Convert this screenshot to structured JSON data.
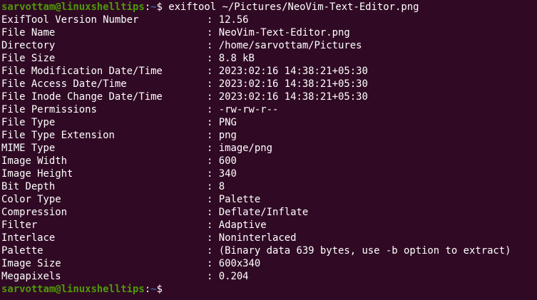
{
  "colors": {
    "background": "#300a24",
    "text": "#ffffff",
    "prompt_user": "#4e9a06",
    "prompt_path": "#3465a4"
  },
  "prompt": {
    "user_host": "sarvottam@linuxshelltips",
    "path": "~",
    "symbol": "$ "
  },
  "command": "exiftool ~/Pictures/NeoVim-Text-Editor.png",
  "rows": [
    {
      "key": "ExifTool Version Number",
      "sep": ": ",
      "value": "12.56"
    },
    {
      "key": "File Name",
      "sep": ": ",
      "value": "NeoVim-Text-Editor.png"
    },
    {
      "key": "Directory",
      "sep": ": ",
      "value": "/home/sarvottam/Pictures"
    },
    {
      "key": "File Size",
      "sep": ": ",
      "value": "8.8 kB"
    },
    {
      "key": "File Modification Date/Time",
      "sep": ": ",
      "value": "2023:02:16 14:38:21+05:30"
    },
    {
      "key": "File Access Date/Time",
      "sep": ": ",
      "value": "2023:02:16 14:38:21+05:30"
    },
    {
      "key": "File Inode Change Date/Time",
      "sep": ": ",
      "value": "2023:02:16 14:38:21+05:30"
    },
    {
      "key": "File Permissions",
      "sep": ": ",
      "value": "-rw-rw-r--"
    },
    {
      "key": "File Type",
      "sep": ": ",
      "value": "PNG"
    },
    {
      "key": "File Type Extension",
      "sep": ": ",
      "value": "png"
    },
    {
      "key": "MIME Type",
      "sep": ": ",
      "value": "image/png"
    },
    {
      "key": "Image Width",
      "sep": ": ",
      "value": "600"
    },
    {
      "key": "Image Height",
      "sep": ": ",
      "value": "340"
    },
    {
      "key": "Bit Depth",
      "sep": ": ",
      "value": "8"
    },
    {
      "key": "Color Type",
      "sep": ": ",
      "value": "Palette"
    },
    {
      "key": "Compression",
      "sep": ": ",
      "value": "Deflate/Inflate"
    },
    {
      "key": "Filter",
      "sep": ": ",
      "value": "Adaptive"
    },
    {
      "key": "Interlace",
      "sep": ": ",
      "value": "Noninterlaced"
    },
    {
      "key": "Palette",
      "sep": ": ",
      "value": "(Binary data 639 bytes, use -b option to extract)"
    },
    {
      "key": "Image Size",
      "sep": ": ",
      "value": "600x340"
    },
    {
      "key": "Megapixels",
      "sep": ": ",
      "value": "0.204"
    }
  ]
}
